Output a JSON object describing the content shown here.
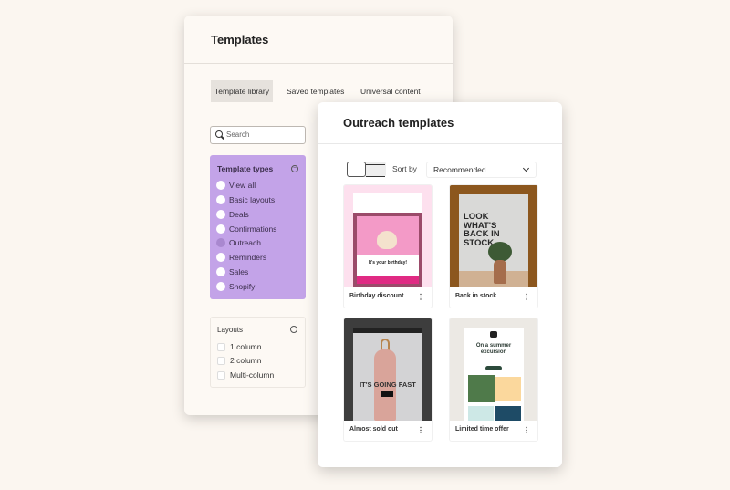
{
  "templates_panel": {
    "title": "Templates",
    "tabs": [
      {
        "label": "Template library",
        "active": true
      },
      {
        "label": "Saved templates",
        "active": false
      },
      {
        "label": "Universal content",
        "active": false
      }
    ],
    "search": {
      "placeholder": "Search"
    },
    "template_types": {
      "title": "Template types",
      "color": "#c3a3e8",
      "options": [
        {
          "label": "View all",
          "selected": false
        },
        {
          "label": "Basic layouts",
          "selected": false
        },
        {
          "label": "Deals",
          "selected": false
        },
        {
          "label": "Confirmations",
          "selected": false
        },
        {
          "label": "Outreach",
          "selected": true
        },
        {
          "label": "Reminders",
          "selected": false
        },
        {
          "label": "Sales",
          "selected": false
        },
        {
          "label": "Shopify",
          "selected": false
        }
      ]
    },
    "layouts": {
      "title": "Layouts",
      "options": [
        {
          "label": "1 column",
          "checked": false
        },
        {
          "label": "2 column",
          "checked": false
        },
        {
          "label": "Multi-column",
          "checked": false
        }
      ]
    }
  },
  "outreach_panel": {
    "title": "Outreach templates",
    "view_mode": "grid",
    "sort_label": "Sort by",
    "sort_value": "Recommended",
    "cards": [
      {
        "label": "Birthday discount",
        "thumb_text": "It's your birthday!"
      },
      {
        "label": "Back in stock",
        "thumb_text": "LOOK WHAT'S BACK IN STOCK"
      },
      {
        "label": "Almost sold out",
        "thumb_text": "IT'S GOING FAST"
      },
      {
        "label": "Limited time offer",
        "thumb_text": "On a summer excursion"
      }
    ]
  }
}
